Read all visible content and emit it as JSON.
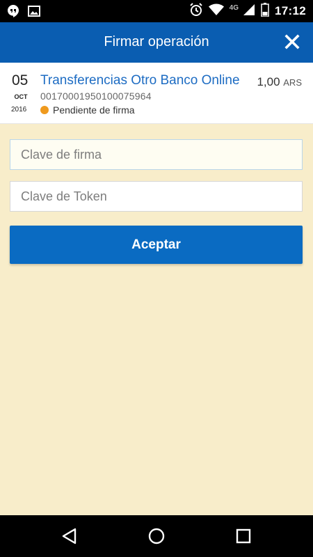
{
  "status_bar": {
    "time": "17:12",
    "network": "4G",
    "icons": [
      "hangouts-icon",
      "image-icon",
      "alarm-icon",
      "wifi-icon",
      "signal-icon",
      "battery-icon"
    ]
  },
  "header": {
    "title": "Firmar operación",
    "close_icon": "close-icon"
  },
  "operation": {
    "day": "05",
    "month": "OCT",
    "year": "2016",
    "title": "Transferencias Otro Banco Online",
    "amount": "1,00",
    "currency": "ARS",
    "number": "00170001950100075964",
    "status": "Pendiente de firma",
    "status_color": "#ef9a1e"
  },
  "form": {
    "clave_firma": {
      "value": "",
      "placeholder": "Clave de firma"
    },
    "clave_token": {
      "value": "",
      "placeholder": "Clave de Token"
    },
    "accept_label": "Aceptar"
  },
  "colors": {
    "app_bar": "#0a5db1",
    "accent": "#0a6bc2",
    "background": "#f8edca",
    "link": "#1d6cc3"
  },
  "nav": {
    "icons": [
      "back-icon",
      "home-icon",
      "recents-icon"
    ]
  }
}
